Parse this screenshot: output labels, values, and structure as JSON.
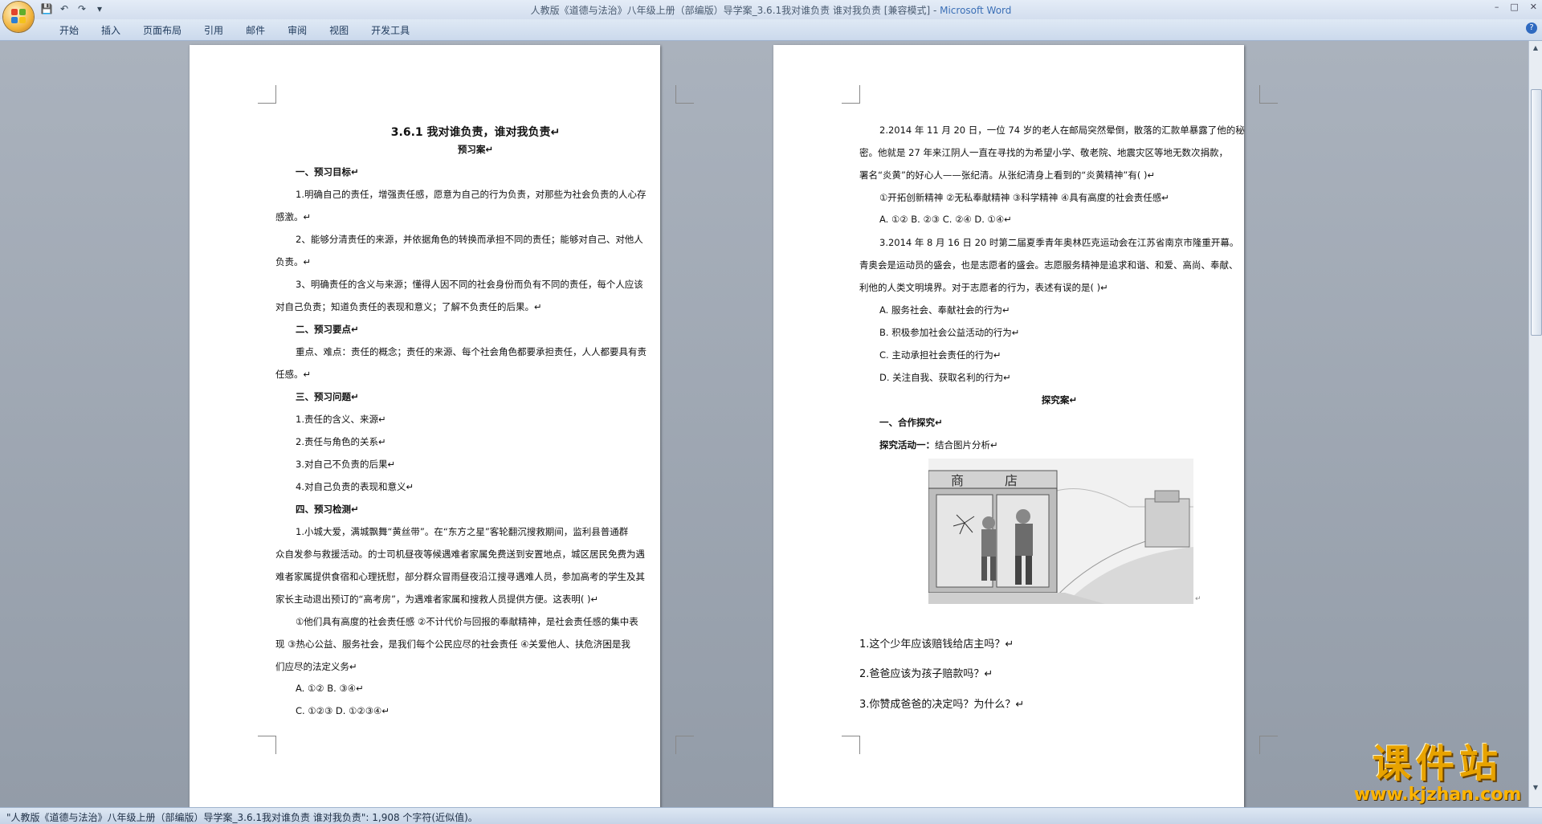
{
  "window": {
    "title": "人教版《道德与法治》八年级上册（部编版）导学案_3.6.1我对谁负责 谁对我负责 [兼容模式]",
    "title_sep": " - ",
    "app_name": "Microsoft Word",
    "controls": [
      "–",
      "□",
      "✕"
    ]
  },
  "qat": {
    "save_icon": "💾",
    "undo_icon": "↶",
    "redo_icon": "↷",
    "more_icon": "▾"
  },
  "ribbon": {
    "tabs": [
      "开始",
      "插入",
      "页面布局",
      "引用",
      "邮件",
      "审阅",
      "视图",
      "开发工具"
    ],
    "help": "?"
  },
  "page1": {
    "lines": [
      "3.6.1 我对谁负责，谁对我负责↵",
      "预习案↵",
      "一、预习目标↵",
      "1.明确自己的责任，增强责任感，愿意为自己的行为负责，对那些为社会负责的人心存",
      "感激。↵",
      "2、能够分清责任的来源，并依据角色的转换而承担不同的责任；能够对自己、对他人",
      "负责。↵",
      "3、明确责任的含义与来源；懂得人因不同的社会身份而负有不同的责任，每个人应该",
      "对自己负责；知道负责任的表现和意义；了解不负责任的后果。↵",
      "二、预习要点↵",
      "重点、难点：责任的概念；责任的来源、每个社会角色都要承担责任，人人都要具有责",
      "任感。↵",
      "三、预习问题↵",
      "1.责任的含义、来源↵",
      "2.责任与角色的关系↵",
      "3.对自己不负责的后果↵",
      "4.对自己负责的表现和意义↵",
      "四、预习检测↵",
      "1.小城大爱，满城飘舞“黄丝带”。在“东方之星”客轮翻沉搜救期间，监利县普通群",
      "众自发参与救援活动。的士司机昼夜等候遇难者家属免费送到安置地点，城区居民免费为遇",
      "难者家属提供食宿和心理抚慰，部分群众冒雨昼夜沿江搜寻遇难人员，参加高考的学生及其",
      "家长主动退出预订的“高考房”，为遇难者家属和搜救人员提供方便。这表明(      )↵",
      "①他们具有高度的社会责任感   ②不计代价与回报的奉献精神，是社会责任感的集中表",
      "现   ③热心公益、服务社会，是我们每个公民应尽的社会责任   ④关爱他人、扶危济困是我",
      "们应尽的法定义务↵",
      "A. ①②        B. ③④↵",
      "C. ①②③       D. ①②③④↵"
    ]
  },
  "page2": {
    "lines": [
      "2.2014 年 11 月 20 日，一位 74 岁的老人在邮局突然晕倒，散落的汇款单暴露了他的秘",
      "密。他就是 27 年来江阴人一直在寻找的为希望小学、敬老院、地震灾区等地无数次捐款，",
      "署名“炎黄”的好心人——张纪清。从张纪清身上看到的“炎黄精神”有(    )↵",
      "①开拓创新精神   ②无私奉献精神   ③科学精神   ④具有高度的社会责任感↵",
      "A. ①②  B. ②③  C. ②④  D. ①④↵",
      "3.2014 年 8 月 16 日 20 时第二届夏季青年奥林匹克运动会在江苏省南京市隆重开幕。",
      "青奥会是运动员的盛会，也是志愿者的盛会。志愿服务精神是追求和谐、和爱、高尚、奉献、",
      "利他的人类文明境界。对于志愿者的行为，表述有误的是(     )↵",
      "A. 服务社会、奉献社会的行为↵",
      "B. 积极参加社会公益活动的行为↵",
      "C. 主动承担社会责任的行为↵",
      "D. 关注自我、获取名利的行为↵",
      "探究案↵",
      "一、合作探究↵",
      "探究活动一：",
      "结合图片分析↵",
      "1.这个少年应该赔钱给店主吗？↵",
      "2.爸爸应该为孩子赔款吗？↵",
      "3.你赞成爸爸的决定吗？为什么？↵"
    ],
    "image_sign_left": "商",
    "image_sign_right": "店",
    "image_mark": "↵"
  },
  "status_bar": {
    "text": "\"人教版《道德与法治》八年级上册（部编版）导学案_3.6.1我对谁负责 谁对我负责\": 1,908 个字符(近似值)。"
  },
  "watermark": {
    "title": "课件站",
    "url": "www.kjzhan.com"
  },
  "colors": {
    "ribbon": "#dfe9f5",
    "page_bg": "#ffffff",
    "desk_bg": "#9aa2ad",
    "watermark": "#e8a300"
  }
}
